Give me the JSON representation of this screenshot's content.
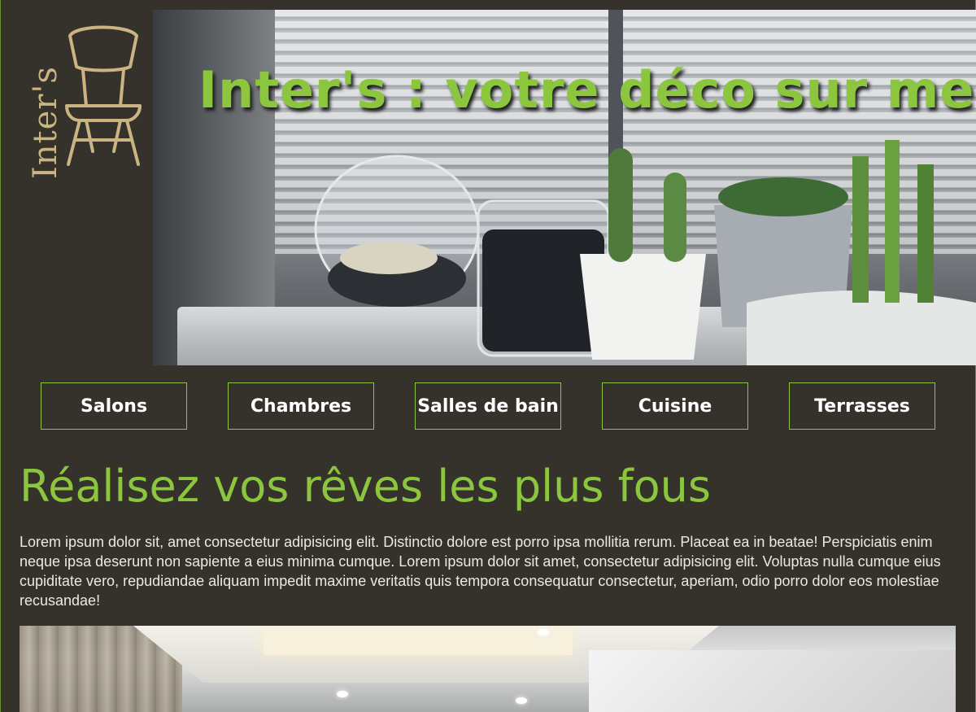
{
  "brand": {
    "name": "Inter's"
  },
  "hero": {
    "title": "Inter's : votre déco sur mesure"
  },
  "nav": {
    "items": [
      {
        "label": "Salons"
      },
      {
        "label": "Chambres"
      },
      {
        "label": "Salles de bain"
      },
      {
        "label": "Cuisine"
      },
      {
        "label": "Terrasses"
      }
    ]
  },
  "main": {
    "title": "Réalisez vos rêves les plus fous",
    "intro": "Lorem ipsum dolor sit, amet consectetur adipisicing elit. Distinctio dolore est porro ipsa mollitia rerum. Placeat ea in beatae! Perspiciatis enim neque ipsa deserunt non sapiente a eius minima cumque. Lorem ipsum dolor sit amet, consectetur adipisicing elit. Voluptas nulla cumque eius cupiditate vero, repudiandae aliquam impedit maxime veritatis quis tempora consequatur consectetur, aperiam, odio porro dolor eos molestiae recusandae!"
  },
  "colors": {
    "background": "#35322c",
    "accent": "#8cc63f",
    "logo": "#c9b482",
    "text": "#ebe9e4"
  },
  "icons": {
    "logo": "chair-icon"
  }
}
